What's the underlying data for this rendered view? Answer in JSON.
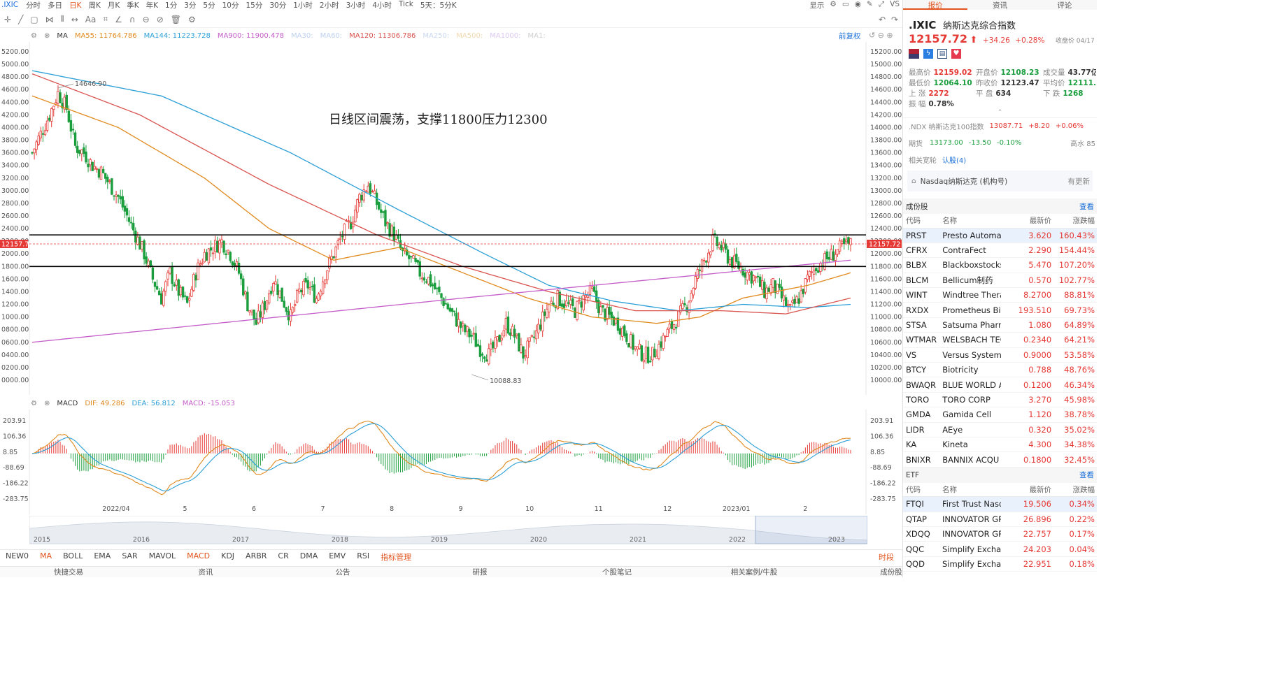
{
  "toolbar": {
    "symbol": ".IXIC",
    "periods": [
      "分时",
      "多日",
      "日K",
      "周K",
      "月K",
      "季K",
      "年K",
      "1分",
      "3分",
      "5分",
      "10分",
      "15分",
      "30分",
      "1小时",
      "2小时",
      "3小时",
      "4小时",
      "Tick",
      "5天：5分K"
    ],
    "active_period": "日K",
    "right": [
      "显示",
      "VS"
    ]
  },
  "ma_legend": [
    {
      "label": "MA",
      "color": "#333333"
    },
    {
      "label": "MA55: 11764.786",
      "color": "#e08a1e"
    },
    {
      "label": "MA144: 11223.728",
      "color": "#2a9fd6"
    },
    {
      "label": "MA900: 11900.478",
      "color": "#c45cc9"
    },
    {
      "label": "MA30:",
      "color": "#bcd0f0"
    },
    {
      "label": "MA60:",
      "color": "#bcd0f0"
    },
    {
      "label": "MA120: 11306.786",
      "color": "#d9534f"
    },
    {
      "label": "MA250:",
      "color": "#c9d9f0"
    },
    {
      "label": "MA500:",
      "color": "#f0d9b0"
    },
    {
      "label": "MA1000:",
      "color": "#dcc8f0"
    },
    {
      "label": "MA1:",
      "color": "#d0d0d0"
    }
  ],
  "fq_label": "前复权",
  "annotation": "日线区间震荡，支撑11800压力12300",
  "price_labels": {
    "high": "14646.90",
    "low": "10088.83",
    "current": "12157.72"
  },
  "price_axis": [
    "15200.00",
    "15000.00",
    "14800.00",
    "14600.00",
    "14400.00",
    "14200.00",
    "14000.00",
    "13800.00",
    "13600.00",
    "13400.00",
    "13200.00",
    "13000.00",
    "12800.00",
    "12600.00",
    "12400.00",
    "12200.00",
    "12000.00",
    "11800.00",
    "11600.00",
    "11400.00",
    "11200.00",
    "11000.00",
    "10800.00",
    "10600.00",
    "10400.00",
    "10200.00",
    "10000.00"
  ],
  "price_axis_left": [
    "5200.00",
    "5000.00",
    "4800.00",
    "4600.00",
    "4400.00",
    "4200.00",
    "4000.00",
    "3800.00",
    "3600.00",
    "3400.00",
    "3200.00",
    "3000.00",
    "2800.00",
    "2600.00",
    "2400.00",
    "2200.00",
    "2000.00",
    "1800.00",
    "1600.00",
    "1400.00",
    "1200.00",
    "1000.00",
    "0800.00",
    "0600.00",
    "0400.00",
    "0200.00",
    "0000.00"
  ],
  "macd_legend": [
    {
      "label": "MACD",
      "color": "#333333"
    },
    {
      "label": "DIF: 49.286",
      "color": "#e08a1e"
    },
    {
      "label": "DEA: 56.812",
      "color": "#2a9fd6"
    },
    {
      "label": "MACD: -15.053",
      "color": "#c45cc9"
    }
  ],
  "macd_axis": [
    "203.91",
    "106.36",
    "8.85",
    "-88.69",
    "-186.22",
    "-283.75"
  ],
  "date_axis": [
    "2022/04",
    "5",
    "6",
    "7",
    "8",
    "9",
    "10",
    "11",
    "12",
    "2023/01",
    "2",
    "3",
    "4"
  ],
  "year_axis": [
    "2015",
    "2016",
    "2017",
    "2018",
    "2019",
    "2020",
    "2021",
    "2022",
    "2023"
  ],
  "indicators": [
    "NEW0",
    "MA",
    "BOLL",
    "EMA",
    "SAR",
    "MAVOL",
    "MACD",
    "KDJ",
    "ARBR",
    "CR",
    "DMA",
    "EMV",
    "RSI",
    "指标管理"
  ],
  "indicators_active": [
    "MA",
    "MACD"
  ],
  "time_label": "时段",
  "footer": [
    "快捷交易",
    "资讯",
    "公告",
    "研报",
    "个股笔记",
    "相关案例/牛股",
    "成份股",
    "ETF"
  ],
  "panel": {
    "tabs": [
      "报价",
      "资讯",
      "评论"
    ],
    "code": ".IXIC",
    "name": "纳斯达克综合指数",
    "price": "12157.72",
    "change": "+34.26",
    "pct": "+0.28%",
    "close_time": "收盘价 04/17 16:00",
    "stats": [
      [
        [
          "最高价",
          "12159.02",
          "red"
        ],
        [
          "开盘价",
          "12108.23",
          "grn"
        ],
        [
          "成交量",
          "43.77亿",
          "dark"
        ]
      ],
      [
        [
          "最低价",
          "12064.10",
          "grn"
        ],
        [
          "昨收价",
          "12123.47",
          "dark"
        ],
        [
          "平均价",
          "12111.56",
          "grn"
        ]
      ],
      [
        [
          "上 涨",
          "2272",
          "red"
        ],
        [
          "平 盘",
          "634",
          "dark"
        ],
        [
          "下 跌",
          "1268",
          "grn"
        ]
      ],
      [
        [
          "振 幅",
          "0.78%",
          "dark"
        ]
      ]
    ],
    "ndx": {
      "label": ".NDX 纳斯达克100指数",
      "price": "13087.71",
      "chg": "+8.20",
      "pct": "+0.06%"
    },
    "futures": {
      "label": "期货",
      "price": "13173.00",
      "chg": "-13.50",
      "pct": "-0.10%",
      "extra": "高水 85"
    },
    "concept": {
      "label": "相关宽轮",
      "value": "认股(4)"
    },
    "org": {
      "label": "Nasdaq纳斯达克 (机构号)",
      "action": "有更新"
    },
    "constituents": {
      "title": "成份股",
      "more": "查看",
      "headers": [
        "代码",
        "名称",
        "最新价",
        "涨跌幅"
      ],
      "rows": [
        [
          "PRST",
          "Presto Automa",
          "3.620",
          "160.43%"
        ],
        [
          "CFRX",
          "ContraFect",
          "2.290",
          "154.44%"
        ],
        [
          "BLBX",
          "Blackboxstocks",
          "5.470",
          "107.20%"
        ],
        [
          "BLCM",
          "Bellicum制药",
          "0.570",
          "102.77%"
        ],
        [
          "WINT",
          "Windtree Thera",
          "8.2700",
          "88.81%"
        ],
        [
          "RXDX",
          "Prometheus Bio",
          "193.510",
          "69.73%"
        ],
        [
          "STSA",
          "Satsuma Pharm",
          "1.080",
          "64.89%"
        ],
        [
          "WTMAR",
          "WELSBACH TEC",
          "0.2340",
          "64.21%"
        ],
        [
          "VS",
          "Versus Systems",
          "0.9000",
          "53.58%"
        ],
        [
          "BTCY",
          "Biotricity",
          "0.788",
          "48.76%"
        ],
        [
          "BWAQR",
          "BLUE WORLD A",
          "0.1200",
          "46.34%"
        ],
        [
          "TORO",
          "TORO CORP",
          "3.270",
          "45.98%"
        ],
        [
          "GMDA",
          "Gamida Cell",
          "1.120",
          "38.78%"
        ],
        [
          "LIDR",
          "AEye",
          "0.320",
          "35.02%"
        ],
        [
          "KA",
          "Kineta",
          "4.300",
          "34.38%"
        ],
        [
          "BNIXR",
          "BANNIX ACQU",
          "0.1800",
          "32.45%"
        ]
      ]
    },
    "etf": {
      "title": "ETF",
      "more": "查看",
      "headers": [
        "代码",
        "名称",
        "最新价",
        "涨跌幅"
      ],
      "rows": [
        [
          "FTQI",
          "First Trust Nasdaq",
          "19.506",
          "0.34%"
        ],
        [
          "QTAP",
          "INNOVATOR GRO",
          "26.896",
          "0.22%"
        ],
        [
          "XDQQ",
          "INNOVATOR GRO",
          "22.757",
          "0.17%"
        ],
        [
          "QQC",
          "Simplify Exchange",
          "24.203",
          "0.04%"
        ],
        [
          "QQD",
          "Simplify Exchange",
          "22.951",
          "0.18%"
        ]
      ]
    }
  },
  "chart_data": {
    "type": "candlestick",
    "title": "日线区间震荡，支撑11800压力12300",
    "y_range": [
      10000,
      15200
    ],
    "support": 11800,
    "resistance": 12300,
    "current": 12157.72,
    "high_label": 14646.9,
    "low_label": 10088.83,
    "x_start": "2022/03",
    "x_end": "2023/04/17",
    "months": [
      "2022/04",
      "5",
      "6",
      "7",
      "8",
      "9",
      "10",
      "11",
      "12",
      "2023/01",
      "2",
      "3",
      "4"
    ],
    "price_path": [
      [
        0,
        13600
      ],
      [
        4,
        13900
      ],
      [
        8,
        14200
      ],
      [
        12,
        14550
      ],
      [
        16,
        14300
      ],
      [
        20,
        13700
      ],
      [
        24,
        13600
      ],
      [
        28,
        13400
      ],
      [
        32,
        13300
      ],
      [
        36,
        13100
      ],
      [
        40,
        12900
      ],
      [
        44,
        12600
      ],
      [
        48,
        12300
      ],
      [
        52,
        12000
      ],
      [
        56,
        11600
      ],
      [
        60,
        11300
      ],
      [
        64,
        11700
      ],
      [
        68,
        11400
      ],
      [
        72,
        11200
      ],
      [
        76,
        11700
      ],
      [
        80,
        12000
      ],
      [
        84,
        12100
      ],
      [
        88,
        12200
      ],
      [
        92,
        12000
      ],
      [
        96,
        11700
      ],
      [
        100,
        11200
      ],
      [
        104,
        10900
      ],
      [
        108,
        11200
      ],
      [
        112,
        11600
      ],
      [
        116,
        11300
      ],
      [
        120,
        11000
      ],
      [
        124,
        11400
      ],
      [
        128,
        11500
      ],
      [
        132,
        11300
      ],
      [
        136,
        11700
      ],
      [
        140,
        12000
      ],
      [
        144,
        12300
      ],
      [
        148,
        12500
      ],
      [
        152,
        12900
      ],
      [
        156,
        13100
      ],
      [
        160,
        12800
      ],
      [
        164,
        12500
      ],
      [
        168,
        12300
      ],
      [
        172,
        12000
      ],
      [
        176,
        11900
      ],
      [
        180,
        11700
      ],
      [
        184,
        11600
      ],
      [
        188,
        11400
      ],
      [
        192,
        11200
      ],
      [
        196,
        11000
      ],
      [
        200,
        10800
      ],
      [
        204,
        10700
      ],
      [
        208,
        10500
      ],
      [
        212,
        10400
      ],
      [
        216,
        10600
      ],
      [
        220,
        10900
      ],
      [
        224,
        10700
      ],
      [
        228,
        10400
      ],
      [
        232,
        10600
      ],
      [
        236,
        10900
      ],
      [
        240,
        11200
      ],
      [
        244,
        11300
      ],
      [
        248,
        11200
      ],
      [
        252,
        11100
      ],
      [
        256,
        11300
      ],
      [
        260,
        11400
      ],
      [
        264,
        11100
      ],
      [
        268,
        11000
      ],
      [
        272,
        10900
      ],
      [
        276,
        10700
      ],
      [
        280,
        10500
      ],
      [
        284,
        10400
      ],
      [
        288,
        10400
      ],
      [
        292,
        10600
      ],
      [
        296,
        10800
      ],
      [
        300,
        11000
      ],
      [
        304,
        11200
      ],
      [
        308,
        11600
      ],
      [
        312,
        11900
      ],
      [
        316,
        12200
      ],
      [
        320,
        12100
      ],
      [
        324,
        11900
      ],
      [
        328,
        11800
      ],
      [
        332,
        11700
      ],
      [
        336,
        11600
      ],
      [
        340,
        11400
      ],
      [
        344,
        11500
      ],
      [
        348,
        11300
      ],
      [
        352,
        11100
      ],
      [
        356,
        11300
      ],
      [
        360,
        11600
      ],
      [
        364,
        11800
      ],
      [
        368,
        11900
      ],
      [
        372,
        12000
      ],
      [
        376,
        12100
      ],
      [
        380,
        12150
      ]
    ],
    "ma_lines": [
      {
        "name": "MA55",
        "color": "#e08a1e",
        "values": [
          [
            0,
            14500
          ],
          [
            40,
            14000
          ],
          [
            80,
            13200
          ],
          [
            110,
            12400
          ],
          [
            140,
            11900
          ],
          [
            170,
            12100
          ],
          [
            200,
            11700
          ],
          [
            230,
            11300
          ],
          [
            260,
            11000
          ],
          [
            290,
            10900
          ],
          [
            310,
            11000
          ],
          [
            330,
            11300
          ],
          [
            360,
            11500
          ],
          [
            380,
            11700
          ]
        ]
      },
      {
        "name": "MA144",
        "color": "#2a9fd6",
        "values": [
          [
            0,
            14900
          ],
          [
            60,
            14500
          ],
          [
            120,
            13600
          ],
          [
            170,
            12700
          ],
          [
            210,
            12000
          ],
          [
            240,
            11500
          ],
          [
            270,
            11250
          ],
          [
            300,
            11100
          ],
          [
            330,
            11200
          ],
          [
            360,
            11150
          ],
          [
            380,
            11200
          ]
        ]
      },
      {
        "name": "MA120",
        "color": "#d9534f",
        "values": [
          [
            0,
            14850
          ],
          [
            50,
            14200
          ],
          [
            110,
            13100
          ],
          [
            160,
            12300
          ],
          [
            200,
            11800
          ],
          [
            240,
            11400
          ],
          [
            280,
            11100
          ],
          [
            320,
            11100
          ],
          [
            350,
            11050
          ],
          [
            380,
            11300
          ]
        ]
      },
      {
        "name": "MA900",
        "color": "#c45cc9",
        "values": [
          [
            0,
            10600
          ],
          [
            100,
            10950
          ],
          [
            200,
            11300
          ],
          [
            290,
            11600
          ],
          [
            380,
            11900
          ]
        ]
      }
    ],
    "macd_range": [
      -283.75,
      203.91
    ]
  }
}
